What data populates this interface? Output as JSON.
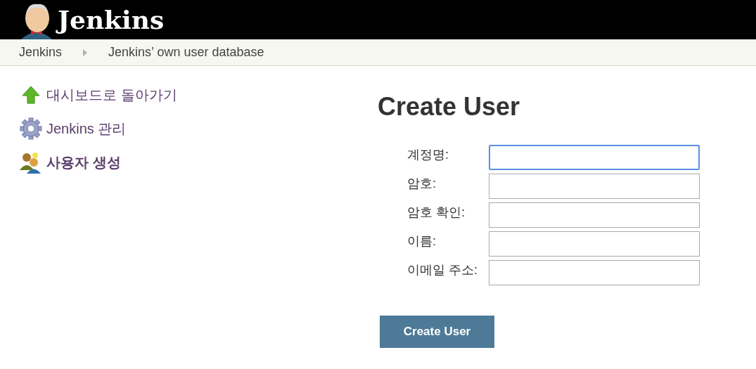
{
  "header": {
    "title": "Jenkins"
  },
  "breadcrumbs": [
    {
      "label": "Jenkins"
    },
    {
      "label": "Jenkins’ own user database"
    }
  ],
  "sidebar": {
    "items": [
      {
        "kind": "up",
        "label": "대시보드로 돌아가기",
        "selected": false
      },
      {
        "kind": "gear",
        "label": "Jenkins 관리",
        "selected": false
      },
      {
        "kind": "users",
        "label": "사용자 생성",
        "selected": true
      }
    ]
  },
  "form": {
    "title": "Create User",
    "fields": [
      {
        "label": "계정명:",
        "focused": true
      },
      {
        "label": "암호:",
        "focused": false
      },
      {
        "label": "암호 확인:",
        "focused": false
      },
      {
        "label": "이름:",
        "focused": false
      },
      {
        "label": "이메일 주소:",
        "focused": false
      }
    ],
    "submit": "Create User"
  }
}
